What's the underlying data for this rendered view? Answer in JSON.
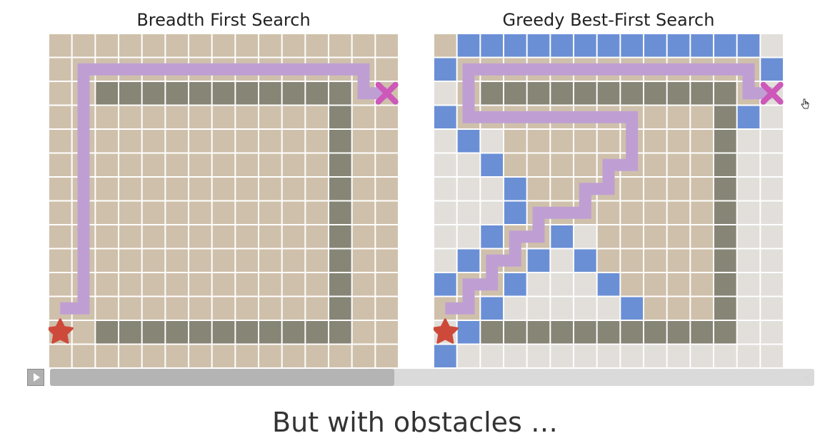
{
  "panels": {
    "left": {
      "title": "Breadth First Search"
    },
    "right": {
      "title": "Greedy Best-First Search"
    }
  },
  "grid": {
    "cols": 15,
    "rows": 14,
    "colors": {
      "frontier": "#6a8fd5",
      "visited": "#cfc0ab",
      "unvisited": "#e2dfdb",
      "wall": "#868576",
      "path": "#bf9fd3",
      "start": "#cd4a3b",
      "goal": "#cd58b9",
      "line": "#ffffff"
    },
    "walls": [
      [
        2,
        2
      ],
      [
        3,
        2
      ],
      [
        4,
        2
      ],
      [
        5,
        2
      ],
      [
        6,
        2
      ],
      [
        7,
        2
      ],
      [
        8,
        2
      ],
      [
        9,
        2
      ],
      [
        10,
        2
      ],
      [
        11,
        2
      ],
      [
        12,
        2
      ],
      [
        12,
        3
      ],
      [
        12,
        4
      ],
      [
        12,
        5
      ],
      [
        12,
        6
      ],
      [
        12,
        7
      ],
      [
        12,
        8
      ],
      [
        12,
        9
      ],
      [
        12,
        10
      ],
      [
        12,
        11
      ],
      [
        12,
        12
      ],
      [
        2,
        12
      ],
      [
        3,
        12
      ],
      [
        4,
        12
      ],
      [
        5,
        12
      ],
      [
        6,
        12
      ],
      [
        7,
        12
      ],
      [
        8,
        12
      ],
      [
        9,
        12
      ],
      [
        10,
        12
      ],
      [
        11,
        12
      ]
    ],
    "start": [
      0,
      12
    ],
    "goal": [
      14,
      2
    ]
  },
  "bfs": {
    "path": [
      [
        0,
        11
      ],
      [
        1,
        11
      ],
      [
        1,
        1
      ],
      [
        13,
        1
      ],
      [
        13,
        2
      ],
      [
        14,
        2
      ]
    ]
  },
  "greedy": {
    "frontier": [
      [
        1,
        0
      ],
      [
        2,
        0
      ],
      [
        3,
        0
      ],
      [
        4,
        0
      ],
      [
        5,
        0
      ],
      [
        6,
        0
      ],
      [
        7,
        0
      ],
      [
        8,
        0
      ],
      [
        9,
        0
      ],
      [
        10,
        0
      ],
      [
        11,
        0
      ],
      [
        12,
        0
      ],
      [
        13,
        0
      ],
      [
        0,
        1
      ],
      [
        14,
        1
      ],
      [
        0,
        3
      ],
      [
        13,
        3
      ],
      [
        1,
        4
      ],
      [
        2,
        5
      ],
      [
        3,
        6
      ],
      [
        3,
        7
      ],
      [
        2,
        8
      ],
      [
        5,
        8
      ],
      [
        1,
        9
      ],
      [
        4,
        9
      ],
      [
        6,
        9
      ],
      [
        0,
        10
      ],
      [
        3,
        10
      ],
      [
        7,
        10
      ],
      [
        2,
        11
      ],
      [
        8,
        11
      ],
      [
        1,
        12
      ],
      [
        0,
        13
      ]
    ],
    "visited": [
      [
        0,
        0
      ],
      [
        1,
        1
      ],
      [
        2,
        1
      ],
      [
        3,
        1
      ],
      [
        4,
        1
      ],
      [
        5,
        1
      ],
      [
        6,
        1
      ],
      [
        7,
        1
      ],
      [
        8,
        1
      ],
      [
        9,
        1
      ],
      [
        10,
        1
      ],
      [
        11,
        1
      ],
      [
        12,
        1
      ],
      [
        13,
        1
      ],
      [
        1,
        2
      ],
      [
        13,
        2
      ],
      [
        1,
        3
      ],
      [
        2,
        3
      ],
      [
        3,
        3
      ],
      [
        4,
        3
      ],
      [
        5,
        3
      ],
      [
        6,
        3
      ],
      [
        7,
        3
      ],
      [
        8,
        3
      ],
      [
        8,
        4
      ],
      [
        8,
        5
      ],
      [
        7,
        5
      ],
      [
        7,
        6
      ],
      [
        6,
        6
      ],
      [
        6,
        7
      ],
      [
        5,
        7
      ],
      [
        4,
        7
      ],
      [
        4,
        8
      ],
      [
        3,
        8
      ],
      [
        3,
        9
      ],
      [
        2,
        9
      ],
      [
        2,
        10
      ],
      [
        1,
        10
      ],
      [
        1,
        11
      ],
      [
        0,
        11
      ],
      [
        3,
        4
      ],
      [
        4,
        4
      ],
      [
        5,
        4
      ],
      [
        6,
        4
      ],
      [
        7,
        4
      ],
      [
        4,
        5
      ],
      [
        5,
        5
      ],
      [
        6,
        5
      ],
      [
        4,
        6
      ],
      [
        5,
        6
      ],
      [
        3,
        5
      ],
      [
        10,
        4
      ],
      [
        10,
        5
      ],
      [
        10,
        6
      ],
      [
        10,
        7
      ],
      [
        10,
        8
      ],
      [
        10,
        9
      ],
      [
        10,
        10
      ],
      [
        10,
        11
      ],
      [
        11,
        3
      ],
      [
        11,
        4
      ],
      [
        11,
        5
      ],
      [
        11,
        6
      ],
      [
        11,
        7
      ],
      [
        11,
        8
      ],
      [
        11,
        9
      ],
      [
        11,
        10
      ],
      [
        11,
        11
      ],
      [
        9,
        4
      ],
      [
        9,
        5
      ],
      [
        9,
        6
      ],
      [
        9,
        7
      ],
      [
        9,
        8
      ],
      [
        9,
        9
      ],
      [
        9,
        10
      ],
      [
        8,
        6
      ],
      [
        8,
        7
      ],
      [
        8,
        8
      ],
      [
        8,
        9
      ],
      [
        8,
        10
      ],
      [
        7,
        7
      ],
      [
        7,
        8
      ],
      [
        7,
        9
      ],
      [
        9,
        11
      ],
      [
        10,
        3
      ],
      [
        9,
        3
      ]
    ],
    "path": [
      [
        0,
        11
      ],
      [
        1,
        11
      ],
      [
        1,
        10
      ],
      [
        2,
        10
      ],
      [
        2,
        9
      ],
      [
        3,
        9
      ],
      [
        3,
        8
      ],
      [
        4,
        8
      ],
      [
        4,
        7
      ],
      [
        6,
        7
      ],
      [
        6,
        6
      ],
      [
        7,
        6
      ],
      [
        7,
        5
      ],
      [
        8,
        5
      ],
      [
        8,
        3
      ],
      [
        1,
        3
      ],
      [
        1,
        1
      ],
      [
        13,
        1
      ],
      [
        13,
        2
      ],
      [
        14,
        2
      ]
    ]
  },
  "player": {
    "progress": 0.45
  },
  "caption": "But with obstacles …"
}
